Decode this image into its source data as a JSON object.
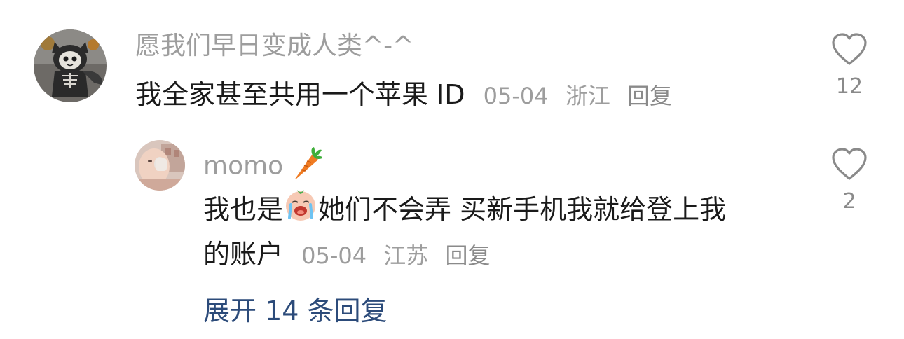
{
  "comments": [
    {
      "username": "愿我们早日变成人类^-^",
      "text": "我全家甚至共用一个苹果 ID",
      "date": "05-04",
      "location": "浙江",
      "reply_label": "回复",
      "likes": "12"
    },
    {
      "username": "momo",
      "username_emoji": "carrot-emoji",
      "text_part1": "我也是",
      "inline_emoji": "crying-face-emoji",
      "text_part2": "她们不会弄 买新手机我就给登上我",
      "text_line2": "的账户",
      "date": "05-04",
      "location": "江苏",
      "reply_label": "回复",
      "likes": "2"
    }
  ],
  "expand": {
    "label": "展开 14 条回复"
  },
  "colors": {
    "username": "#9d9d9d",
    "text": "#1a1a1a",
    "link": "#2c4b7a"
  }
}
